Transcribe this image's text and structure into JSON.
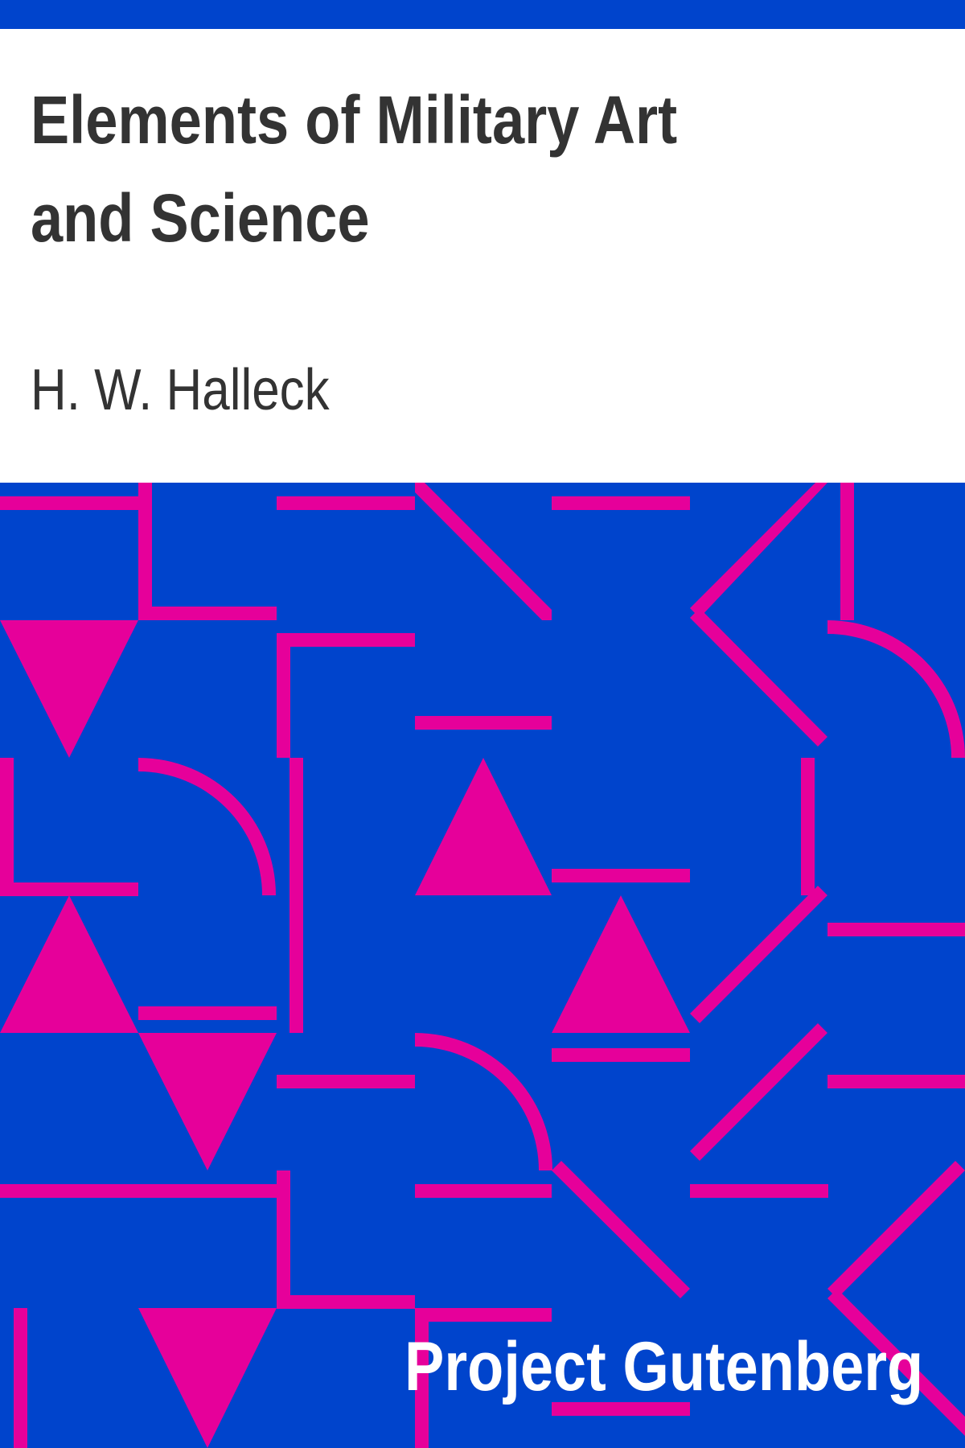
{
  "cover": {
    "title": "Elements of Military Art and Science",
    "author": "H. W. Halleck",
    "publisher": "Project Gutenberg"
  },
  "colors": {
    "background_top": "#ffffff",
    "pattern_background": "#0044cc",
    "pattern_accent": "#e6009a",
    "title_text": "#333333",
    "publisher_text": "#ffffff"
  }
}
